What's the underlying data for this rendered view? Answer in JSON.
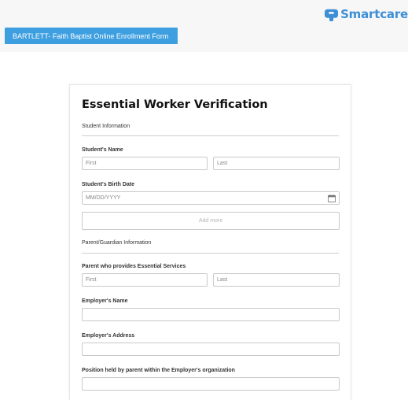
{
  "brand": {
    "name": "Smartcare"
  },
  "form_tab": {
    "label": "BARTLETT- Faith Baptist Online Enrollment Form"
  },
  "form": {
    "title": "Essential Worker Verification",
    "student_section": "Student Information",
    "student_name_label": "Student's Name",
    "student_first_placeholder": "First",
    "student_last_placeholder": "Last",
    "birth_date_label": "Student's Birth Date",
    "birth_date_placeholder": "MM/DD/YYYY",
    "add_more_label": "Add more",
    "parent_section": "Parent/Guardian Information",
    "parent_name_label": "Parent who provides Essential Services",
    "parent_first_placeholder": "First",
    "parent_last_placeholder": "Last",
    "employer_name_label": "Employer's Name",
    "employer_address_label": "Employer's Address",
    "position_label": "Position held by parent within the Employer's organization"
  },
  "icons": {
    "brand": "smartcare-logo-icon",
    "calendar": "calendar-icon"
  },
  "colors": {
    "brand": "#3d8fd6",
    "tab": "#3e9fe0"
  }
}
